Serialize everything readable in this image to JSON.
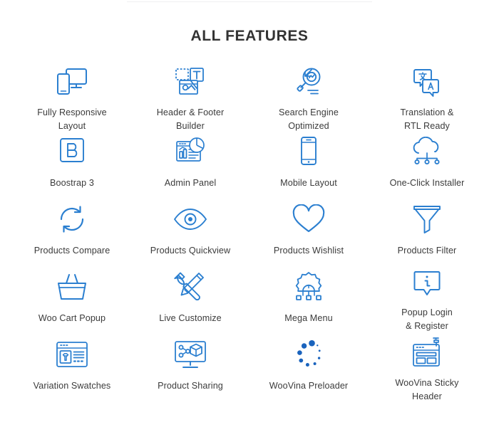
{
  "section": {
    "title": "ALL FEATURES"
  },
  "colors": {
    "icon_blue": "#2b7fd0",
    "icon_blue_dark": "#1a63bd",
    "title_text": "#333333",
    "label_text": "#3b3b3b",
    "background": "#ffffff",
    "top_rule": "#f0f0f1"
  },
  "features": [
    {
      "icon": "responsive-devices-icon",
      "label": "Fully Responsive\nLayout"
    },
    {
      "icon": "header-footer-builder-icon",
      "label": "Header & Footer\nBuilder"
    },
    {
      "icon": "search-engine-optimized-icon",
      "label": "Search Engine\nOptimized"
    },
    {
      "icon": "translation-rtl-icon",
      "label": "Translation &\nRTL Ready"
    },
    {
      "icon": "bootstrap-icon",
      "label": "Boostrap 3"
    },
    {
      "icon": "admin-panel-icon",
      "label": "Admin Panel"
    },
    {
      "icon": "mobile-layout-icon",
      "label": "Mobile Layout"
    },
    {
      "icon": "one-click-installer-icon",
      "label": "One-Click Installer"
    },
    {
      "icon": "products-compare-icon",
      "label": "Products Compare"
    },
    {
      "icon": "products-quickview-icon",
      "label": "Products Quickview"
    },
    {
      "icon": "products-wishlist-icon",
      "label": "Products Wishlist"
    },
    {
      "icon": "products-filter-icon",
      "label": "Products Filter"
    },
    {
      "icon": "woo-cart-popup-icon",
      "label": "Woo Cart Popup"
    },
    {
      "icon": "live-customize-icon",
      "label": "Live Customize"
    },
    {
      "icon": "mega-menu-icon",
      "label": "Mega Menu"
    },
    {
      "icon": "popup-login-register-icon",
      "label": "Popup Login\n& Register"
    },
    {
      "icon": "variation-swatches-icon",
      "label": "Variation Swatches"
    },
    {
      "icon": "product-sharing-icon",
      "label": "Product Sharing"
    },
    {
      "icon": "woovina-preloader-icon",
      "label": "WooVina Preloader"
    },
    {
      "icon": "woovina-sticky-header-icon",
      "label": "WooVina Sticky\nHeader"
    }
  ]
}
